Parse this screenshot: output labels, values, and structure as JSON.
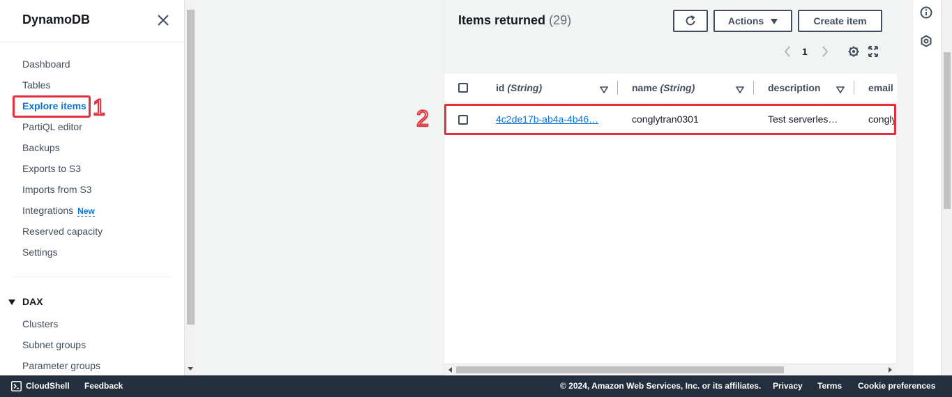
{
  "sidebar": {
    "title": "DynamoDB",
    "items": [
      {
        "label": "Dashboard"
      },
      {
        "label": "Tables"
      },
      {
        "label": "Explore items"
      },
      {
        "label": "PartiQL editor"
      },
      {
        "label": "Backups"
      },
      {
        "label": "Exports to S3"
      },
      {
        "label": "Imports from S3"
      },
      {
        "label": "Integrations",
        "badge": "New"
      },
      {
        "label": "Reserved capacity"
      },
      {
        "label": "Settings"
      }
    ],
    "dax": {
      "label": "DAX",
      "items": [
        {
          "label": "Clusters"
        },
        {
          "label": "Subnet groups"
        },
        {
          "label": "Parameter groups"
        }
      ]
    }
  },
  "annotations": {
    "one": "1",
    "two": "2"
  },
  "items": {
    "title": "Items returned",
    "count": "(29)",
    "actions_label": "Actions",
    "create_label": "Create item",
    "page": "1",
    "columns": {
      "id": "id",
      "id_type": "(String)",
      "name": "name",
      "name_type": "(String)",
      "description": "description",
      "email": "email"
    },
    "rows": [
      {
        "id": "4c2de17b-ab4a-4b46…",
        "name": "conglytran0301",
        "description": "Test serverles…",
        "email": "congly"
      }
    ]
  },
  "footer": {
    "cloudshell": "CloudShell",
    "feedback": "Feedback",
    "copyright": "© 2024, Amazon Web Services, Inc. or its affiliates.",
    "privacy": "Privacy",
    "terms": "Terms",
    "cookie": "Cookie preferences"
  },
  "colors": {
    "accent": "#0972d3",
    "annotation": "#e4303c",
    "footer_bg": "#232f3e"
  }
}
